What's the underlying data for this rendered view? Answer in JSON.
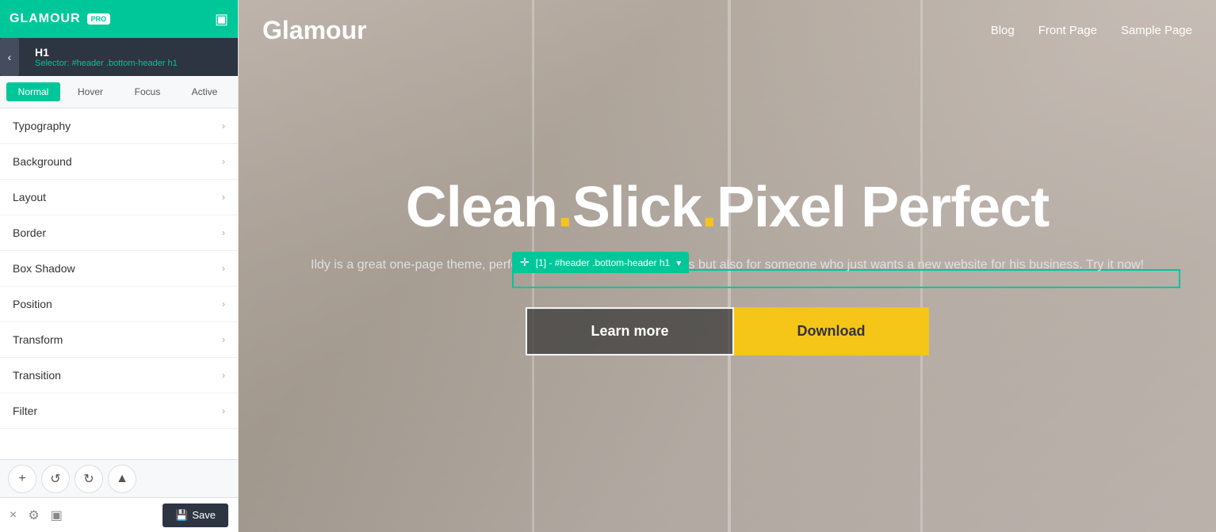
{
  "brand": {
    "name": "GLAMOUR",
    "badge": "PRO"
  },
  "element": {
    "tag": "H1",
    "selector": "#header .bottom-header h1"
  },
  "states": {
    "tabs": [
      "Normal",
      "Hover",
      "Focus",
      "Active"
    ],
    "active": "Normal"
  },
  "sections": [
    {
      "label": "Typography"
    },
    {
      "label": "Background"
    },
    {
      "label": "Layout"
    },
    {
      "label": "Border"
    },
    {
      "label": "Box Shadow"
    },
    {
      "label": "Position"
    },
    {
      "label": "Transform"
    },
    {
      "label": "Transition"
    },
    {
      "label": "Filter"
    }
  ],
  "toolbar": {
    "add_label": "+",
    "undo_label": "↺",
    "redo_label": "↻",
    "pointer_label": "▲",
    "save_label": "Save"
  },
  "footer": {
    "close_icon": "×",
    "settings_icon": "⚙",
    "responsive_icon": "▣"
  },
  "preview": {
    "site_logo": "Glamour",
    "nav_items": [
      "Blog",
      "Front Page",
      "Sample Page"
    ],
    "selector_label": "[1] - #header .bottom-header h1",
    "hero_title_part1": "Clean",
    "hero_title_dot1": ".",
    "hero_title_part2": "Slick",
    "hero_title_dot2": ".",
    "hero_title_part3": "Pixel Perfect",
    "hero_subtitle": "Ildy is a great one-page theme, perfect for developers and designers but also for someone who just wants a new website for his business. Try it now!",
    "btn_learn_more": "Learn more",
    "btn_download": "Download"
  },
  "colors": {
    "accent": "#00c79a",
    "dot_color": "#f5c518",
    "dark_header": "#2d3442"
  }
}
